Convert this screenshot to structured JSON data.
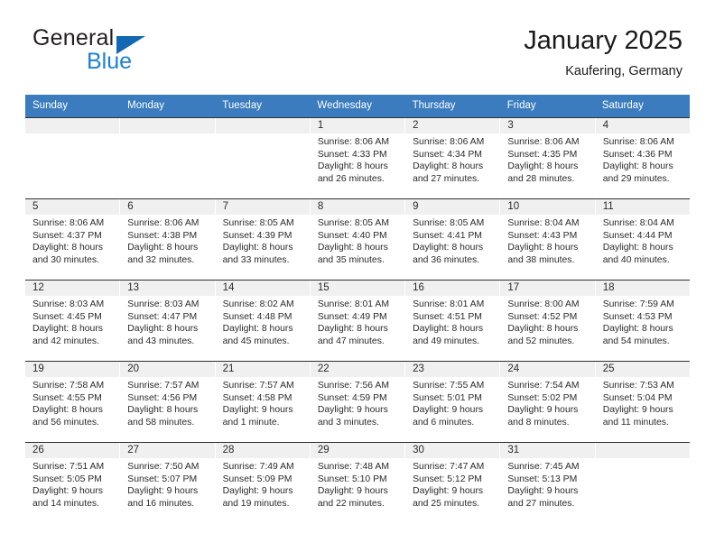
{
  "brand": {
    "name_part1": "General",
    "name_part2": "Blue",
    "triangle_color": "#1268b3",
    "blue_color": "#1d81d3"
  },
  "header": {
    "title": "January 2025",
    "subtitle": "Kaufering, Germany"
  },
  "theme": {
    "header_row_bg": "#3a7cbe",
    "header_row_text": "#ffffff",
    "day_band_bg": "#f0f0f0",
    "cell_bg": "#ffffff",
    "grid_line": "#2f2f2f"
  },
  "weekdays": [
    "Sunday",
    "Monday",
    "Tuesday",
    "Wednesday",
    "Thursday",
    "Friday",
    "Saturday"
  ],
  "weeks": [
    [
      {
        "day": "",
        "lines": []
      },
      {
        "day": "",
        "lines": []
      },
      {
        "day": "",
        "lines": []
      },
      {
        "day": "1",
        "lines": [
          "Sunrise: 8:06 AM",
          "Sunset: 4:33 PM",
          "Daylight: 8 hours",
          "and 26 minutes."
        ]
      },
      {
        "day": "2",
        "lines": [
          "Sunrise: 8:06 AM",
          "Sunset: 4:34 PM",
          "Daylight: 8 hours",
          "and 27 minutes."
        ]
      },
      {
        "day": "3",
        "lines": [
          "Sunrise: 8:06 AM",
          "Sunset: 4:35 PM",
          "Daylight: 8 hours",
          "and 28 minutes."
        ]
      },
      {
        "day": "4",
        "lines": [
          "Sunrise: 8:06 AM",
          "Sunset: 4:36 PM",
          "Daylight: 8 hours",
          "and 29 minutes."
        ]
      }
    ],
    [
      {
        "day": "5",
        "lines": [
          "Sunrise: 8:06 AM",
          "Sunset: 4:37 PM",
          "Daylight: 8 hours",
          "and 30 minutes."
        ]
      },
      {
        "day": "6",
        "lines": [
          "Sunrise: 8:06 AM",
          "Sunset: 4:38 PM",
          "Daylight: 8 hours",
          "and 32 minutes."
        ]
      },
      {
        "day": "7",
        "lines": [
          "Sunrise: 8:05 AM",
          "Sunset: 4:39 PM",
          "Daylight: 8 hours",
          "and 33 minutes."
        ]
      },
      {
        "day": "8",
        "lines": [
          "Sunrise: 8:05 AM",
          "Sunset: 4:40 PM",
          "Daylight: 8 hours",
          "and 35 minutes."
        ]
      },
      {
        "day": "9",
        "lines": [
          "Sunrise: 8:05 AM",
          "Sunset: 4:41 PM",
          "Daylight: 8 hours",
          "and 36 minutes."
        ]
      },
      {
        "day": "10",
        "lines": [
          "Sunrise: 8:04 AM",
          "Sunset: 4:43 PM",
          "Daylight: 8 hours",
          "and 38 minutes."
        ]
      },
      {
        "day": "11",
        "lines": [
          "Sunrise: 8:04 AM",
          "Sunset: 4:44 PM",
          "Daylight: 8 hours",
          "and 40 minutes."
        ]
      }
    ],
    [
      {
        "day": "12",
        "lines": [
          "Sunrise: 8:03 AM",
          "Sunset: 4:45 PM",
          "Daylight: 8 hours",
          "and 42 minutes."
        ]
      },
      {
        "day": "13",
        "lines": [
          "Sunrise: 8:03 AM",
          "Sunset: 4:47 PM",
          "Daylight: 8 hours",
          "and 43 minutes."
        ]
      },
      {
        "day": "14",
        "lines": [
          "Sunrise: 8:02 AM",
          "Sunset: 4:48 PM",
          "Daylight: 8 hours",
          "and 45 minutes."
        ]
      },
      {
        "day": "15",
        "lines": [
          "Sunrise: 8:01 AM",
          "Sunset: 4:49 PM",
          "Daylight: 8 hours",
          "and 47 minutes."
        ]
      },
      {
        "day": "16",
        "lines": [
          "Sunrise: 8:01 AM",
          "Sunset: 4:51 PM",
          "Daylight: 8 hours",
          "and 49 minutes."
        ]
      },
      {
        "day": "17",
        "lines": [
          "Sunrise: 8:00 AM",
          "Sunset: 4:52 PM",
          "Daylight: 8 hours",
          "and 52 minutes."
        ]
      },
      {
        "day": "18",
        "lines": [
          "Sunrise: 7:59 AM",
          "Sunset: 4:53 PM",
          "Daylight: 8 hours",
          "and 54 minutes."
        ]
      }
    ],
    [
      {
        "day": "19",
        "lines": [
          "Sunrise: 7:58 AM",
          "Sunset: 4:55 PM",
          "Daylight: 8 hours",
          "and 56 minutes."
        ]
      },
      {
        "day": "20",
        "lines": [
          "Sunrise: 7:57 AM",
          "Sunset: 4:56 PM",
          "Daylight: 8 hours",
          "and 58 minutes."
        ]
      },
      {
        "day": "21",
        "lines": [
          "Sunrise: 7:57 AM",
          "Sunset: 4:58 PM",
          "Daylight: 9 hours",
          "and 1 minute."
        ]
      },
      {
        "day": "22",
        "lines": [
          "Sunrise: 7:56 AM",
          "Sunset: 4:59 PM",
          "Daylight: 9 hours",
          "and 3 minutes."
        ]
      },
      {
        "day": "23",
        "lines": [
          "Sunrise: 7:55 AM",
          "Sunset: 5:01 PM",
          "Daylight: 9 hours",
          "and 6 minutes."
        ]
      },
      {
        "day": "24",
        "lines": [
          "Sunrise: 7:54 AM",
          "Sunset: 5:02 PM",
          "Daylight: 9 hours",
          "and 8 minutes."
        ]
      },
      {
        "day": "25",
        "lines": [
          "Sunrise: 7:53 AM",
          "Sunset: 5:04 PM",
          "Daylight: 9 hours",
          "and 11 minutes."
        ]
      }
    ],
    [
      {
        "day": "26",
        "lines": [
          "Sunrise: 7:51 AM",
          "Sunset: 5:05 PM",
          "Daylight: 9 hours",
          "and 14 minutes."
        ]
      },
      {
        "day": "27",
        "lines": [
          "Sunrise: 7:50 AM",
          "Sunset: 5:07 PM",
          "Daylight: 9 hours",
          "and 16 minutes."
        ]
      },
      {
        "day": "28",
        "lines": [
          "Sunrise: 7:49 AM",
          "Sunset: 5:09 PM",
          "Daylight: 9 hours",
          "and 19 minutes."
        ]
      },
      {
        "day": "29",
        "lines": [
          "Sunrise: 7:48 AM",
          "Sunset: 5:10 PM",
          "Daylight: 9 hours",
          "and 22 minutes."
        ]
      },
      {
        "day": "30",
        "lines": [
          "Sunrise: 7:47 AM",
          "Sunset: 5:12 PM",
          "Daylight: 9 hours",
          "and 25 minutes."
        ]
      },
      {
        "day": "31",
        "lines": [
          "Sunrise: 7:45 AM",
          "Sunset: 5:13 PM",
          "Daylight: 9 hours",
          "and 27 minutes."
        ]
      },
      {
        "day": "",
        "lines": []
      }
    ]
  ]
}
